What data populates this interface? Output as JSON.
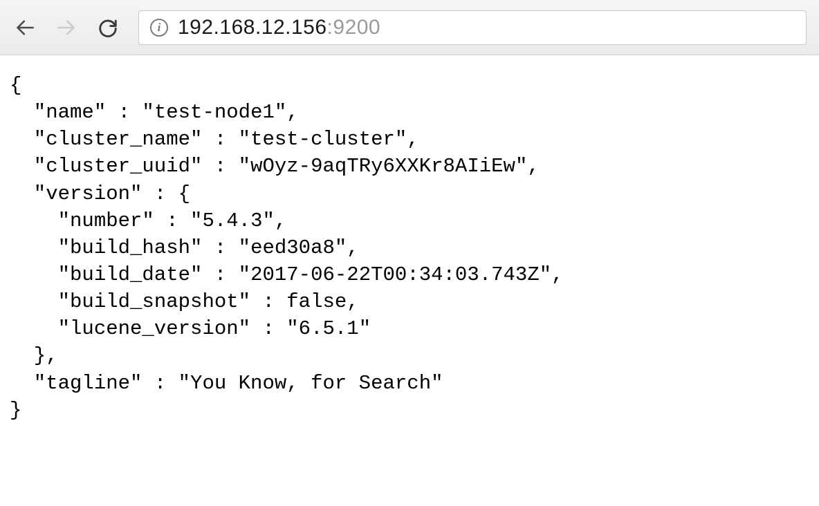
{
  "address": {
    "host": "192.168.12.156",
    "port": ":9200"
  },
  "info_glyph": "i",
  "response": {
    "name": "test-node1",
    "cluster_name": "test-cluster",
    "cluster_uuid": "wOyz-9aqTRy6XXKr8AIiEw",
    "version": {
      "number": "5.4.3",
      "build_hash": "eed30a8",
      "build_date": "2017-06-22T00:34:03.743Z",
      "build_snapshot": "false",
      "lucene_version": "6.5.1"
    },
    "tagline": "You Know, for Search"
  }
}
